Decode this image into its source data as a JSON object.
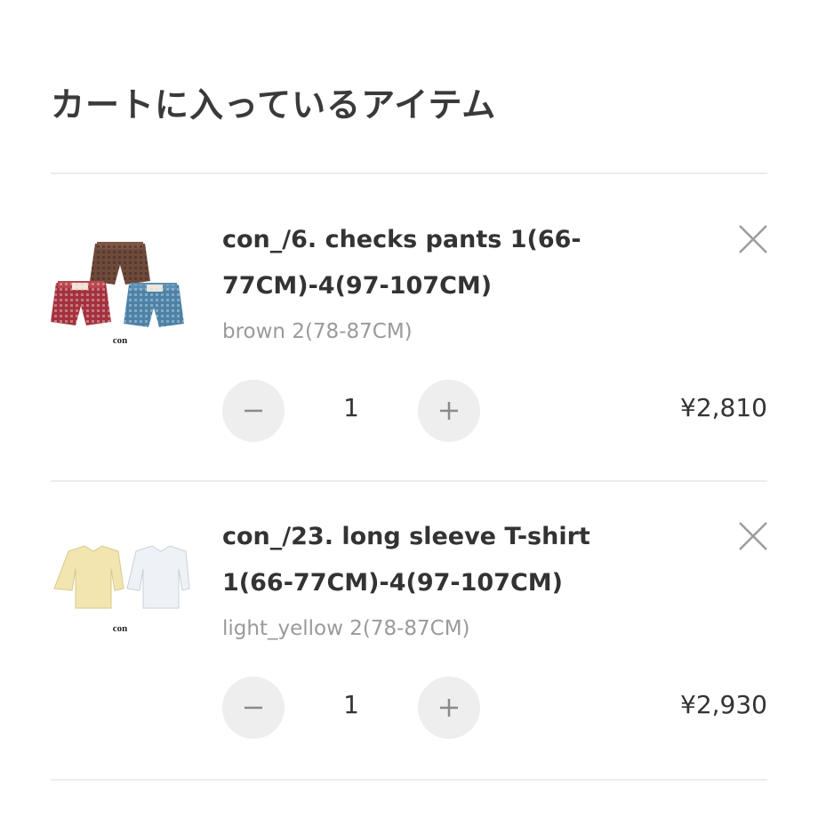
{
  "page_title": "カートに入っているアイテム",
  "items": [
    {
      "name": "con_/6. checks pants 1(66-77CM)-4(97-107CM)",
      "variant": "brown 2(78-87CM)",
      "quantity": "1",
      "price": "¥2,810",
      "thumb_label": "con"
    },
    {
      "name": "con_/23. long sleeve T-shirt 1(66-77CM)-4(97-107CM)",
      "variant": "light_yellow 2(78-87CM)",
      "quantity": "1",
      "price": "¥2,930",
      "thumb_label": "con"
    }
  ],
  "icons": {
    "remove": "close-icon",
    "decrease": "minus-icon",
    "increase": "plus-icon"
  },
  "colors": {
    "text": "#333333",
    "muted": "#9a9a9a",
    "button_bg": "#eeeeee",
    "divider": "#ececec"
  }
}
